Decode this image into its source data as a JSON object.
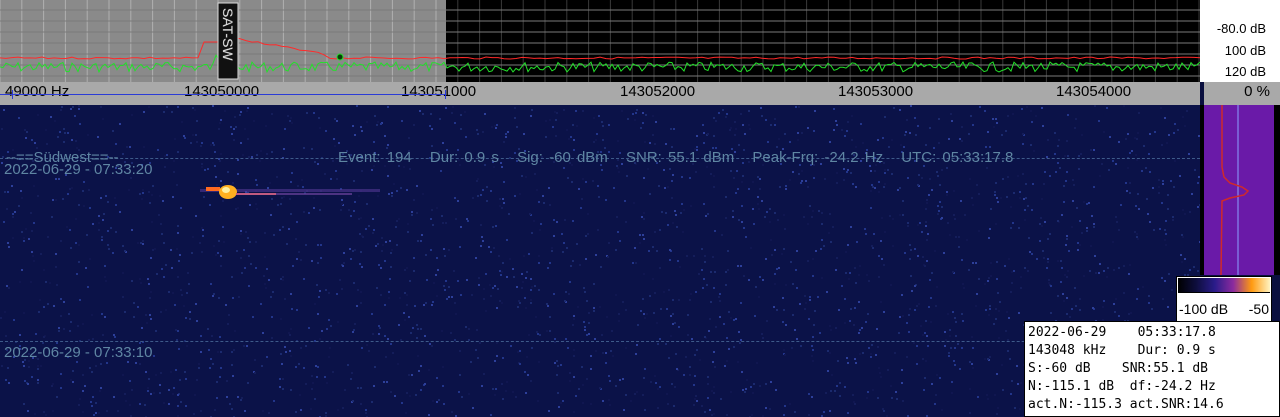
{
  "spectrum": {
    "db_labels": [
      "-80.0 dB",
      "100 dB",
      "120 dB"
    ],
    "overlay_text": "SAT-SW",
    "colors": {
      "grid": "#cfcfcf",
      "noise_trace": "#23e02a",
      "peak_trace": "#ff2a2a",
      "grey_zone": "#8a8a8a"
    }
  },
  "ruler": {
    "labels": [
      "49000 Hz",
      "143050000",
      "143051000",
      "143052000",
      "143053000",
      "143054000"
    ],
    "percent": "0 %"
  },
  "waterfall": {
    "station": "--==Südwest==--",
    "event": {
      "event": "Event: 194",
      "dur": "Dur: 0.9 s",
      "sig": "Sig: -60 dBm",
      "snr": "SNR: 55.1 dBm",
      "peak": "Peak-Frq: -24.2 Hz",
      "utc": "UTC: 05:33:17.8"
    },
    "timestamps": [
      "2022-06-29 - 07:33:20",
      "2022-06-29 - 07:33:10"
    ]
  },
  "colorbar": {
    "min_label": "-100 dB",
    "max_label": "-50"
  },
  "info_box": {
    "lines": [
      "2022-06-29    05:33:17.8",
      "143048 kHz    Dur: 0.9 s",
      "S:-60 dB    SNR:55.1 dB",
      "N:-115.1 dB  df:-24.2 Hz",
      "act.N:-115.3 act.SNR:14.6"
    ]
  }
}
